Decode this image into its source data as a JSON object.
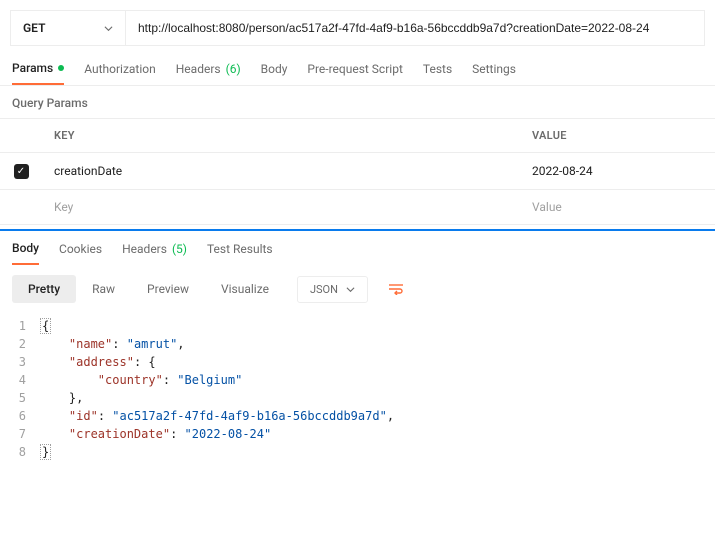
{
  "request": {
    "method": "GET",
    "url": "http://localhost:8080/person/ac517a2f-47fd-4af9-b16a-56bccddb9a7d?creationDate=2022-08-24"
  },
  "tabs": {
    "params": "Params",
    "authorization": "Authorization",
    "headers": "Headers",
    "headers_count": "(6)",
    "body": "Body",
    "prerequest": "Pre-request Script",
    "tests": "Tests",
    "settings": "Settings"
  },
  "query": {
    "title": "Query Params",
    "head_key": "KEY",
    "head_value": "VALUE",
    "row_key": "creationDate",
    "row_value": "2022-08-24",
    "ph_key": "Key",
    "ph_value": "Value"
  },
  "response": {
    "tabs": {
      "body": "Body",
      "cookies": "Cookies",
      "headers": "Headers",
      "headers_count": "(5)",
      "tests": "Test Results"
    },
    "views": {
      "pretty": "Pretty",
      "raw": "Raw",
      "preview": "Preview",
      "visualize": "Visualize",
      "type": "JSON"
    },
    "json": {
      "l1": "{",
      "l2_k": "\"name\"",
      "l2_v": "\"amrut\"",
      "l3_k": "\"address\"",
      "l4_k": "\"country\"",
      "l4_v": "\"Belgium\"",
      "l6_k": "\"id\"",
      "l6_v": "\"ac517a2f-47fd-4af9-b16a-56bccddb9a7d\"",
      "l7_k": "\"creationDate\"",
      "l7_v": "\"2022-08-24\"",
      "l8": "}"
    }
  },
  "chart_data": {
    "type": "table",
    "title": "Response JSON body",
    "object": {
      "name": "amrut",
      "address": {
        "country": "Belgium"
      },
      "id": "ac517a2f-47fd-4af9-b16a-56bccddb9a7d",
      "creationDate": "2022-08-24"
    }
  }
}
